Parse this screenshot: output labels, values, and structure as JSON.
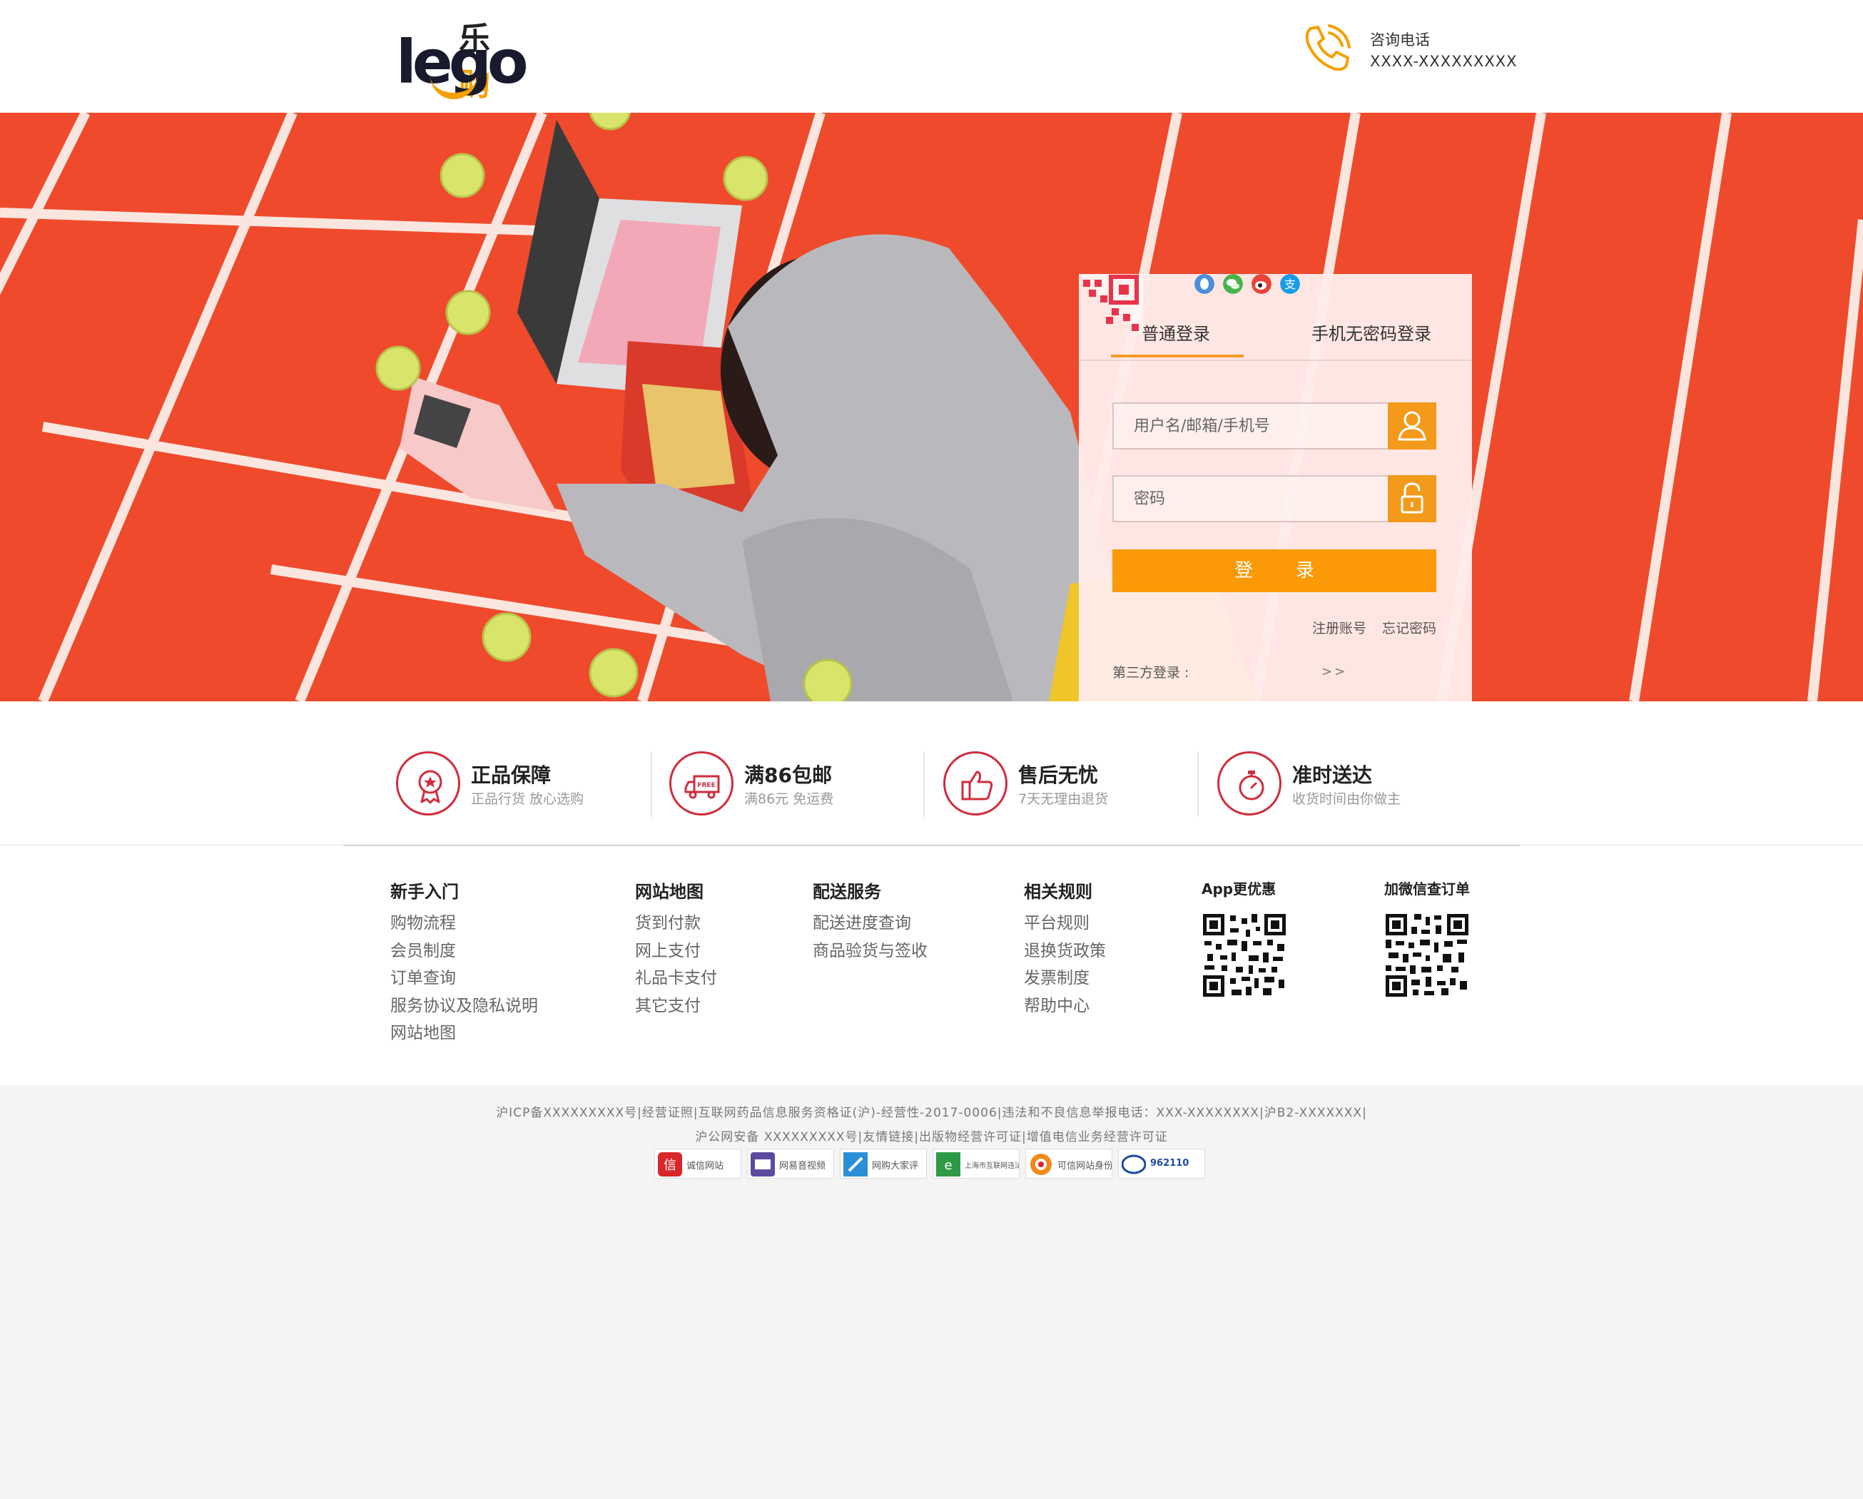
{
  "header": {
    "logo_cn": "乐购",
    "logo_en": "lego",
    "hotline_label": "咨询电话",
    "hotline_number": "XXXX-XXXXXXXXX"
  },
  "login": {
    "tab_normal": "普通登录",
    "tab_mobile": "手机无密码登录",
    "username_placeholder": "用户名/邮箱/手机号",
    "password_placeholder": "密码",
    "login_button": "登录",
    "register": "注册账号",
    "forgot": "忘记密码",
    "third_party_label": "第三方登录 :",
    "third_party": [
      "qq-icon",
      "wechat-icon",
      "weibo-icon",
      "alipay-icon"
    ],
    "more": ">>"
  },
  "features": [
    {
      "title": "正品保障",
      "subtitle": "正品行货 放心选购",
      "icon": "medal-icon"
    },
    {
      "title": "满86包邮",
      "subtitle": "满86元 免运费",
      "icon": "truck-icon"
    },
    {
      "title": "售后无忧",
      "subtitle": "7天无理由退货",
      "icon": "thumbs-up-icon"
    },
    {
      "title": "准时送达",
      "subtitle": "收货时间由你做主",
      "icon": "stopwatch-icon"
    }
  ],
  "footer_columns": [
    {
      "title": "新手入门",
      "items": [
        "购物流程",
        "会员制度",
        "订单查询",
        "服务协议及隐私说明",
        "网站地图"
      ]
    },
    {
      "title": "网站地图",
      "items": [
        "货到付款",
        "网上支付",
        "礼品卡支付",
        "其它支付"
      ]
    },
    {
      "title": "配送服务",
      "items": [
        "配送进度查询",
        "商品验货与签收"
      ]
    },
    {
      "title": "相关规则",
      "items": [
        "平台规则",
        "退换货政策",
        "发票制度",
        "帮助中心"
      ]
    }
  ],
  "qr": {
    "app": "App更优惠",
    "wechat": "加微信查订单"
  },
  "copyright": {
    "line1": "沪ICP备XXXXXXXXX号|经营证照|互联网药品信息服务资格证(沪)-经营性-2017-0006|违法和不良信息举报电话：XXX-XXXXXXXX|沪B2-XXXXXXX|",
    "line2": "沪公网安备 XXXXXXXXX号|友情链接|出版物经营许可证|增值电信业务经营许可证"
  },
  "badges": [
    "诚信网站",
    "网易音视频",
    "网购大家评",
    "上海市互联网违法和不良信息举报中心",
    "可信网站身份验证",
    "962110"
  ],
  "colors": {
    "accent": "#fb9a06",
    "brand_red": "#cf2d3d",
    "banner_red": "#ef4a2c"
  }
}
